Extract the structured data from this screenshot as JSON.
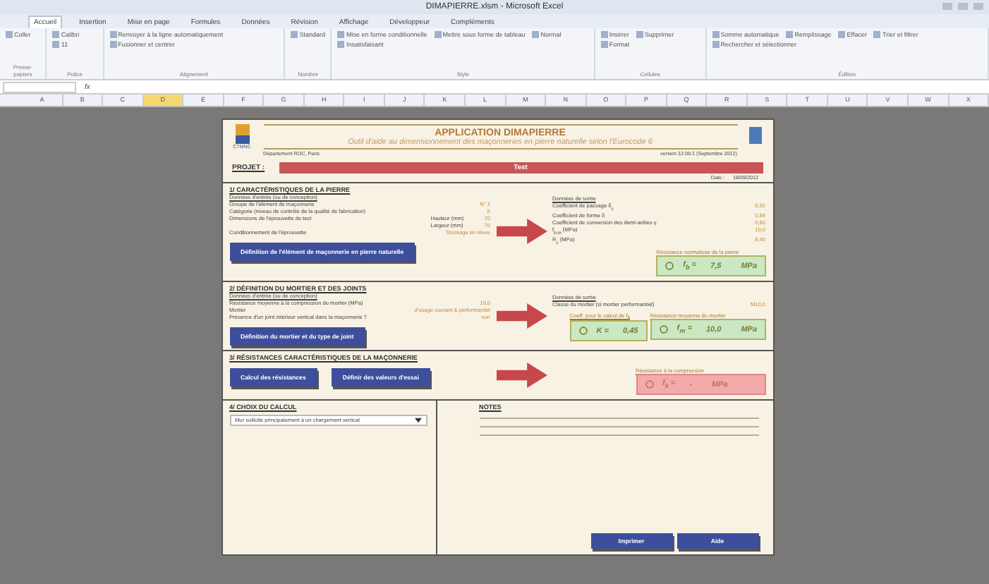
{
  "window": {
    "title": "DIMAPIERRE.xlsm - Microsoft Excel"
  },
  "ribbon": {
    "tabs": [
      {
        "label": "Accueil",
        "selected": true
      },
      {
        "label": "Insertion",
        "selected": false
      },
      {
        "label": "Mise en page",
        "selected": false
      },
      {
        "label": "Formules",
        "selected": false
      },
      {
        "label": "Données",
        "selected": false
      },
      {
        "label": "Révision",
        "selected": false
      },
      {
        "label": "Affichage",
        "selected": false
      },
      {
        "label": "Développeur",
        "selected": false
      },
      {
        "label": "Compléments",
        "selected": false
      }
    ],
    "groups": [
      {
        "label": "Presse-papiers",
        "commands": [
          "Coller"
        ]
      },
      {
        "label": "Police",
        "commands": [
          "Calibri",
          "11"
        ]
      },
      {
        "label": "Alignement",
        "commands": [
          "Renvoyer à la ligne automatiquement",
          "Fusionner et centrer"
        ]
      },
      {
        "label": "Nombre",
        "commands": [
          "Standard"
        ]
      },
      {
        "label": "Style",
        "commands": [
          "Mise en forme conditionnelle",
          "Mettre sous forme de tableau",
          "Normal",
          "Insatisfaisant"
        ]
      },
      {
        "label": "Cellules",
        "commands": [
          "Insérer",
          "Supprimer",
          "Format"
        ]
      },
      {
        "label": "Édition",
        "commands": [
          "Somme automatique",
          "Remplissage",
          "Effacer",
          "Trier et filtrer",
          "Rechercher et sélectionner"
        ]
      }
    ]
  },
  "formula_bar": {
    "fx": "fx"
  },
  "columns": [
    {
      "label": "A",
      "selected": false
    },
    {
      "label": "B",
      "selected": false
    },
    {
      "label": "C",
      "selected": false
    },
    {
      "label": "D",
      "selected": true
    },
    {
      "label": "E",
      "selected": false
    },
    {
      "label": "F",
      "selected": false
    },
    {
      "label": "G",
      "selected": false
    },
    {
      "label": "H",
      "selected": false
    },
    {
      "label": "I",
      "selected": false
    },
    {
      "label": "J",
      "selected": false
    },
    {
      "label": "K",
      "selected": false
    },
    {
      "label": "L",
      "selected": false
    },
    {
      "label": "M",
      "selected": false
    },
    {
      "label": "N",
      "selected": false
    },
    {
      "label": "O",
      "selected": false
    },
    {
      "label": "P",
      "selected": false
    },
    {
      "label": "Q",
      "selected": false
    },
    {
      "label": "R",
      "selected": false
    },
    {
      "label": "S",
      "selected": false
    },
    {
      "label": "T",
      "selected": false
    },
    {
      "label": "U",
      "selected": false
    },
    {
      "label": "V",
      "selected": false
    },
    {
      "label": "W",
      "selected": false
    },
    {
      "label": "X",
      "selected": false
    }
  ],
  "header": {
    "logo_text": "CTMNC",
    "title": "APPLICATION DIMAPIERRE",
    "subtitle": "Outil d'aide au dimensionnement des maçonneries en pierre naturelle selon l'Eurocode 6",
    "department": "Département ROC, Paris",
    "version": "version 12.09.1 (Septembre 2012)"
  },
  "project": {
    "label": "PROJET :",
    "name": "Test",
    "date_label": "Date :",
    "date": "18/09/2012"
  },
  "sections": [
    {
      "title": "1/ CARACTÉRISTIQUES DE LA PIERRE",
      "inputs_title": "Données d'entrée (ou de conception)",
      "inputs": [
        {
          "label": "Groupe de l'élément de maçonnerie",
          "value": "N° 1"
        },
        {
          "label": "Catégorie (niveau de contrôle de la qualité de fabrication)",
          "value": "II"
        },
        {
          "label": "Dimensions de l'éprouvette de test",
          "sub": "Hauteur (mm)",
          "value": "70"
        },
        {
          "sub": "Largeur (mm)",
          "value": "70"
        },
        {
          "label": "Conditionnement de l'éprouvette",
          "value": "Stockage en étuve"
        }
      ],
      "buttons": [
        "Définition de l'élément de maçonnerie en pierre naturelle"
      ],
      "outputs_title": "Données de sortie",
      "outputs": [
        {
          "label": "Coefficient de passage δ$_{c}$",
          "value": "0,92"
        },
        {
          "label": "Coefficient de forme δ",
          "value": "0,84"
        },
        {
          "label": "Coefficient de conversion des demi-arêtes γ",
          "value": "0,80"
        },
        {
          "label": "f$_{b,m}$ (MPa)",
          "value": "10,0"
        },
        {
          "label": "R$_{c}$ (MPa)",
          "value": "8,40"
        }
      ],
      "results": [
        {
          "caption": "Résistance normalisée de la pierre",
          "symbol": "f$_{b}$ =",
          "value": "7,5",
          "unit": "MPa",
          "error": false
        }
      ]
    },
    {
      "title": "2/ DÉFINITION DU MORTIER ET DES JOINTS",
      "inputs_title": "Données d'entrée (ou de conception)",
      "inputs": [
        {
          "label": "Résistance moyenne à la compression du mortier (MPa)",
          "value": "10,0"
        },
        {
          "label": "Mortier",
          "value": "d'usage courant & performantiel"
        },
        {
          "label": "Présence d'un joint intérieur vertical dans la maçonnerie ?",
          "value": "non"
        }
      ],
      "buttons": [
        "Définition du mortier et du type de joint"
      ],
      "outputs_title": "Données de sortie",
      "outputs": [
        {
          "label": "Classe du mortier (si mortier performantiel)",
          "value": "M10,0"
        }
      ],
      "results": [
        {
          "caption": "Coeff. pour le calcul de f$_{k}$",
          "symbol": "K =",
          "value": "0,45",
          "error": false
        },
        {
          "caption": "Résistance moyenne du mortier",
          "symbol": "f$_{m}$ =",
          "value": "10,0",
          "unit": "MPa",
          "error": false
        }
      ]
    },
    {
      "title": "3/ RÉSISTANCES CARACTÉRISTIQUES DE LA MAÇONNERIE",
      "buttons": [
        "Calcul des résistances",
        "Définir des valeurs d'essai"
      ],
      "results": [
        {
          "caption": "Résistance à la compression",
          "symbol": "f$_{k}$ =",
          "value": "-",
          "unit": "MPa",
          "error": true
        }
      ]
    }
  ],
  "calculation": {
    "title": "4/ CHOIX DU CALCUL",
    "dropdown": "Mur sollicité principalement à un chargement vertical"
  },
  "notes": {
    "title": "NOTES"
  },
  "actions": [
    "Imprimer",
    "Aide"
  ]
}
